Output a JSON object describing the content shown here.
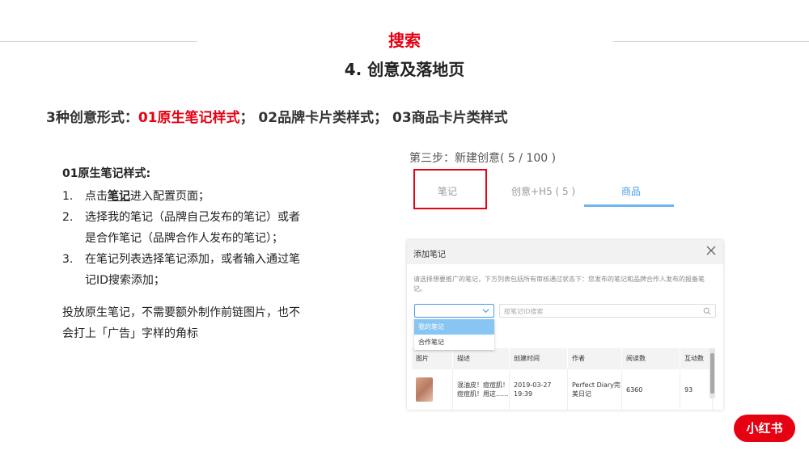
{
  "slide": {
    "title": "搜索",
    "subtitle": "4. 创意及落地页",
    "headline": {
      "prefix": "3种创意形式：",
      "highlight": "01原生笔记样式",
      "rest": "；  02品牌卡片类样式；  03商品卡片类样式"
    }
  },
  "left": {
    "subtitle": "01原生笔记样式:",
    "steps": [
      {
        "num": "1.",
        "pre": "点击",
        "keyword": "笔记",
        "post": "进入配置页面；"
      },
      {
        "num": "2.",
        "text": "选择我的笔记（品牌自己发布的笔记）或者是合作笔记（品牌合作人发布的笔记）；"
      },
      {
        "num": "3.",
        "text": "在笔记列表选择笔记添加，或者输入通过笔记ID搜索添加；"
      }
    ],
    "note": "投放原生笔记，不需要额外制作前链图片，也不会打上「广告」字样的角标"
  },
  "ui": {
    "step_title": "第三步：新建创意( 5 / 100 )",
    "tabs": {
      "note": "笔记",
      "h5": "创意+H5 ( 5 )",
      "goods": "商品"
    },
    "modal": {
      "title": "添加笔记",
      "description": "请选择想要推广的笔记，下方列表包括所有审核通过状态下：您发布的笔记和品牌合作人发布的报备笔记。",
      "select_value": "",
      "search_placeholder": "按笔记ID搜索",
      "dropdown": [
        "我的笔记",
        "合作笔记"
      ],
      "table": {
        "headers": [
          "图片",
          "描述",
          "创建时间",
          "作者",
          "阅读数",
          "互动数"
        ],
        "rows": [
          {
            "desc": "混油皮！痘痘肌！痘痘肌！用这......",
            "created": "2019-03-27 19:39",
            "author": "Perfect Diary完美日记",
            "reads": "6360",
            "interactions": "93"
          }
        ]
      }
    }
  },
  "logo": {
    "text": "小红书"
  },
  "colors": {
    "accent": "#e60012",
    "tab_active": "#4a9be8",
    "dropdown_selected": "#87c5f3"
  },
  "icons": {
    "close": "close-icon",
    "chevron": "chevron-down-icon",
    "search": "search-icon"
  }
}
